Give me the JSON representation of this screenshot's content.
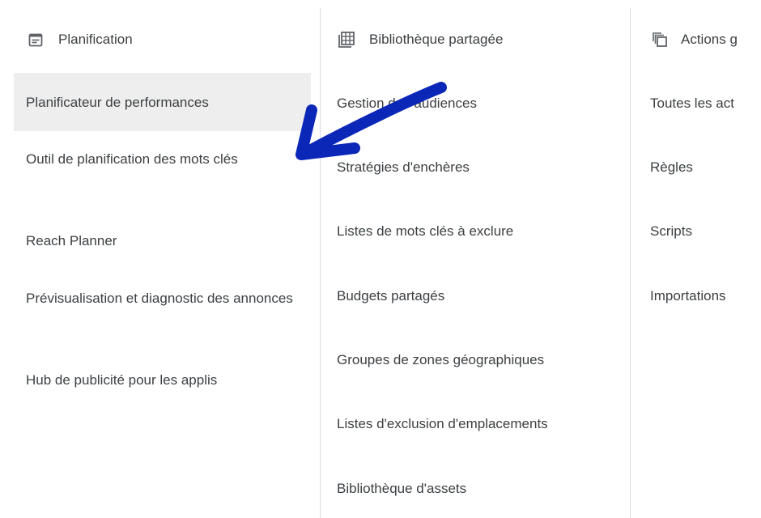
{
  "columns": [
    {
      "header": "Planification",
      "icon": "calendar-note-icon",
      "items": [
        "Planificateur de performances",
        "Outil de planification des mots clés",
        "Reach Planner",
        "Prévisualisation et diagnostic des annonces",
        "Hub de publicité pour les applis"
      ],
      "selected_index": 0
    },
    {
      "header": "Bibliothèque partagée",
      "icon": "library-grid-icon",
      "items": [
        "Gestion des audiences",
        "Stratégies d'enchères",
        "Listes de mots clés à exclure",
        "Budgets partagés",
        "Groupes de zones géographiques",
        "Listes d'exclusion d'emplacements",
        "Bibliothèque d'assets"
      ]
    },
    {
      "header": "Actions g",
      "icon": "bulk-actions-icon",
      "items": [
        "Toutes les act",
        "Règles",
        "Scripts",
        "Importations"
      ]
    }
  ],
  "colors": {
    "text": "#3c4043",
    "selected_bg": "#eeeeee",
    "divider": "#dadce0",
    "annotation_arrow": "#0a27b8"
  }
}
